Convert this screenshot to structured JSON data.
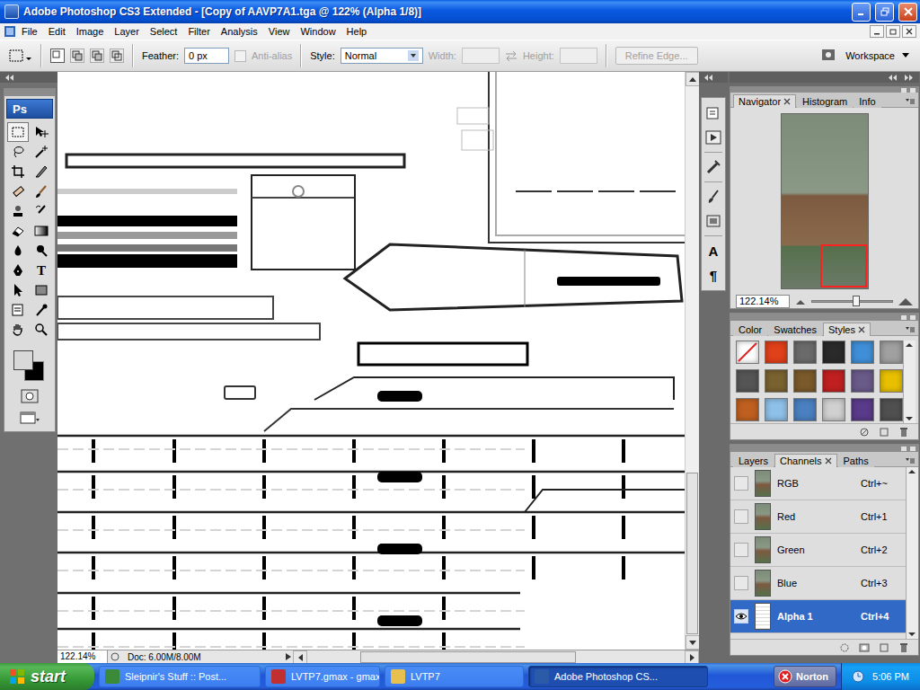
{
  "window": {
    "title": "Adobe Photoshop CS3 Extended - [Copy of AAVP7A1.tga @ 122% (Alpha 1/8)]"
  },
  "menu": [
    "File",
    "Edit",
    "Image",
    "Layer",
    "Select",
    "Filter",
    "Analysis",
    "View",
    "Window",
    "Help"
  ],
  "options": {
    "feather_label": "Feather:",
    "feather": "0 px",
    "antialias_label": "Anti-alias",
    "antialias_checked": false,
    "antialias_disabled": true,
    "style_label": "Style:",
    "style": "Normal",
    "width_label": "Width:",
    "height_label": "Height:",
    "refine_edge": "Refine Edge...",
    "workspace": "Workspace"
  },
  "toolbox": {
    "logo": "Ps",
    "type_tool": "T"
  },
  "canvas": {
    "zoom": "122.14%",
    "doc_size": "Doc: 6.00M/8.00M"
  },
  "dock": {
    "glyphs": [
      "A",
      "¶"
    ]
  },
  "navigator": {
    "tabs": [
      {
        "label": "Navigator",
        "selected": true
      },
      {
        "label": "Histogram",
        "selected": false
      },
      {
        "label": "Info",
        "selected": false
      }
    ],
    "zoom": "122.14%",
    "level": 0.55
  },
  "styles_panel": {
    "tabs": [
      {
        "label": "Color",
        "selected": false
      },
      {
        "label": "Swatches",
        "selected": false
      },
      {
        "label": "Styles",
        "selected": true
      }
    ],
    "swatches": [
      {
        "kind": "none",
        "color": "#ffffff"
      },
      {
        "kind": "fill",
        "color": "#e0401a"
      },
      {
        "kind": "fill",
        "color": "#6a6a6a"
      },
      {
        "kind": "fill",
        "color": "#2a2a2a"
      },
      {
        "kind": "fill",
        "color": "#3f8fd8"
      },
      {
        "kind": "fill",
        "color": "#a0a0a0"
      },
      {
        "kind": "fill",
        "color": "#555555"
      },
      {
        "kind": "fill",
        "color": "#7a6230"
      },
      {
        "kind": "fill",
        "color": "#7a5a2a"
      },
      {
        "kind": "fill",
        "color": "#c02020"
      },
      {
        "kind": "fill",
        "color": "#6a5a8a"
      },
      {
        "kind": "fill",
        "color": "#e8c000"
      },
      {
        "kind": "fill",
        "color": "#c06020"
      },
      {
        "kind": "fill",
        "color": "#8ec0e8"
      },
      {
        "kind": "fill",
        "color": "#4a80c0"
      },
      {
        "kind": "fill",
        "color": "#d0d0d0"
      },
      {
        "kind": "fill",
        "color": "#5a3a8a"
      },
      {
        "kind": "fill",
        "color": "#505050"
      }
    ]
  },
  "channels_panel": {
    "tabs": [
      {
        "label": "Layers",
        "selected": false
      },
      {
        "label": "Channels",
        "selected": true
      },
      {
        "label": "Paths",
        "selected": false
      }
    ],
    "channels": [
      {
        "name": "RGB",
        "shortcut": "Ctrl+~",
        "kind": "color",
        "visible": false,
        "selected": false
      },
      {
        "name": "Red",
        "shortcut": "Ctrl+1",
        "kind": "color",
        "visible": false,
        "selected": false
      },
      {
        "name": "Green",
        "shortcut": "Ctrl+2",
        "kind": "color",
        "visible": false,
        "selected": false
      },
      {
        "name": "Blue",
        "shortcut": "Ctrl+3",
        "kind": "color",
        "visible": false,
        "selected": false
      },
      {
        "name": "Alpha 1",
        "shortcut": "Ctrl+4",
        "kind": "alpha",
        "visible": true,
        "selected": true
      }
    ]
  },
  "taskbar": {
    "start": "start",
    "items": [
      {
        "label": "Sleipnir's Stuff :: Post...",
        "selected": false
      },
      {
        "label": "LVTP7.gmax - gmax",
        "selected": false
      },
      {
        "label": "LVTP7",
        "selected": false
      },
      {
        "label": "Adobe Photoshop CS...",
        "selected": true
      }
    ],
    "norton": "Norton",
    "clock": "5:06 PM"
  }
}
